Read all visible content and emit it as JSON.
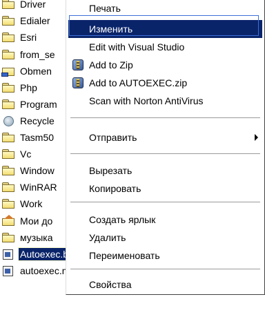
{
  "files": [
    {
      "label": "Driver",
      "icon": "folder-icon"
    },
    {
      "label": "Edialer",
      "icon": "folder-icon"
    },
    {
      "label": "Esri",
      "icon": "folder-icon"
    },
    {
      "label": "from_se",
      "icon": "folder-icon"
    },
    {
      "label": "Obmen",
      "icon": "network-folder-icon"
    },
    {
      "label": "Php",
      "icon": "folder-icon"
    },
    {
      "label": "Program",
      "icon": "folder-icon"
    },
    {
      "label": "Recycle",
      "icon": "recycle-bin-icon"
    },
    {
      "label": "Tasm50",
      "icon": "folder-icon"
    },
    {
      "label": "Vc",
      "icon": "folder-icon"
    },
    {
      "label": "Window",
      "icon": "folder-icon"
    },
    {
      "label": "WinRAR",
      "icon": "folder-icon"
    },
    {
      "label": "Work",
      "icon": "folder-icon"
    },
    {
      "label": "Мои до",
      "icon": "home-folder-icon"
    },
    {
      "label": "музыка",
      "icon": "folder-icon"
    },
    {
      "label": "Autoexec.bat",
      "icon": "system-file-icon",
      "selected": true
    },
    {
      "label": "autoexec.nav",
      "icon": "system-file-icon"
    }
  ],
  "menu": {
    "items": [
      {
        "label": "Печать"
      },
      {
        "label": "Изменить",
        "highlighted": true
      },
      {
        "label": "Edit with Visual Studio"
      },
      {
        "label": "Add to Zip",
        "icon": "winzip-icon"
      },
      {
        "label": "Add to AUTOEXEC.zip",
        "icon": "winzip-icon"
      },
      {
        "label": "Scan with Norton AntiVirus"
      },
      {
        "label": "Отправить",
        "submenu": true
      },
      {
        "label": "Вырезать"
      },
      {
        "label": "Копировать"
      },
      {
        "label": "Создать ярлык"
      },
      {
        "label": "Удалить"
      },
      {
        "label": "Переименовать"
      },
      {
        "label": "Свойства"
      }
    ]
  },
  "colors": {
    "selection": "#0a246a",
    "focus_outline": "#3c6fd8"
  }
}
